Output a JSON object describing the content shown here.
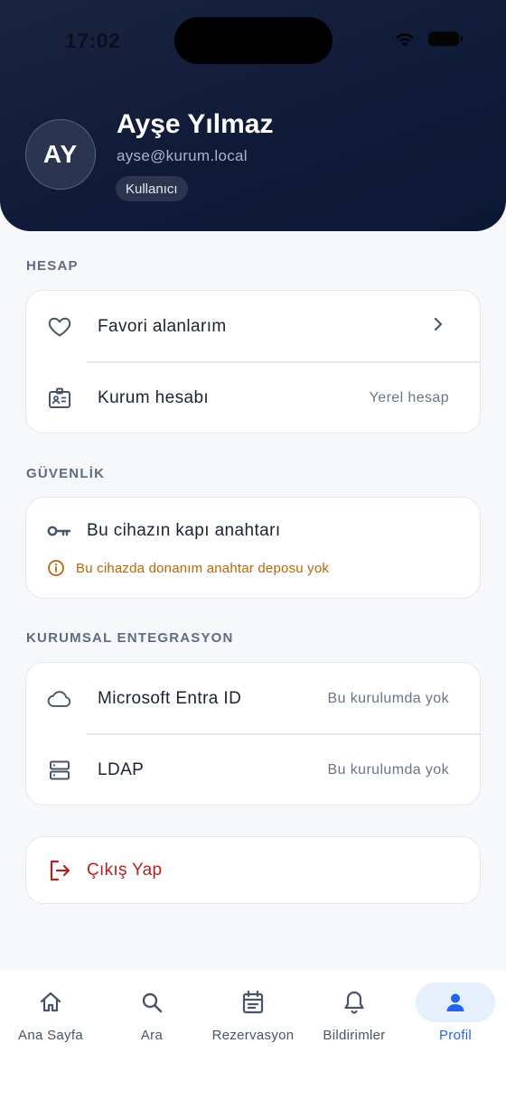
{
  "status_bar": {
    "time": "17:02"
  },
  "profile": {
    "initials": "AY",
    "name": "Ayşe Yılmaz",
    "email": "ayse@kurum.local",
    "role": "Kullanıcı"
  },
  "sections": {
    "account": {
      "title": "HESAP",
      "favorites_label": "Favori alanlarım",
      "org_account_label": "Kurum hesabı",
      "org_account_value": "Yerel hesap"
    },
    "security": {
      "title": "GÜVENLİK",
      "passkey_label": "Bu cihazın kapı anahtarı",
      "passkey_warning": "Bu cihazda donanım anahtar deposu yok"
    },
    "integration": {
      "title": "KURUMSAL ENTEGRASYON",
      "entra_label": "Microsoft Entra ID",
      "entra_value": "Bu kurulumda yok",
      "ldap_label": "LDAP",
      "ldap_value": "Bu kurulumda yok"
    }
  },
  "logout_label": "Çıkış Yap",
  "tabs": [
    {
      "label": "Ana Sayfa",
      "icon": "home-icon"
    },
    {
      "label": "Ara",
      "icon": "search-icon"
    },
    {
      "label": "Rezervasyon",
      "icon": "calendar-icon"
    },
    {
      "label": "Bildirimler",
      "icon": "bell-icon"
    },
    {
      "label": "Profil",
      "icon": "user-icon",
      "active": true
    }
  ],
  "colors": {
    "header": "#0f1a38",
    "accent": "#2563eb",
    "warning": "#b8660a",
    "danger": "#b3211f"
  }
}
